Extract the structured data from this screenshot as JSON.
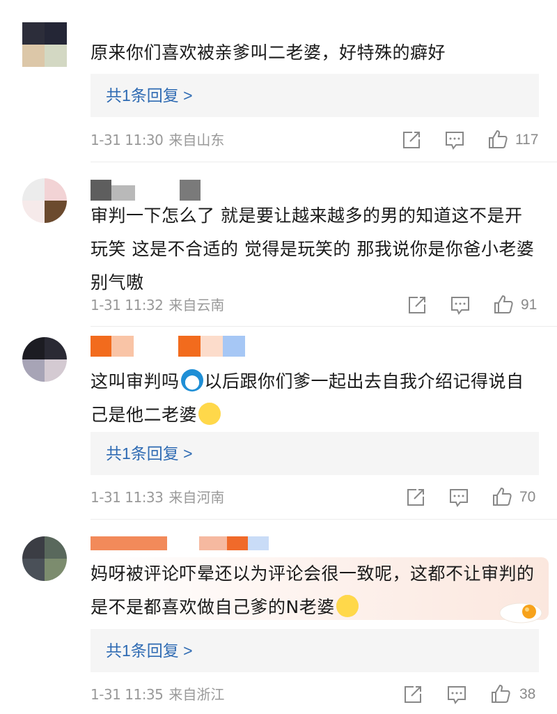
{
  "colors": {
    "link": "#2f6bb3",
    "meta": "#999999",
    "reply_bg": "#f5f5f5",
    "divider": "#ececec"
  },
  "comments": [
    {
      "text": "原来你们喜欢被亲爹叫二老婆，好特殊的癖好",
      "reply_label": "共1条回复 >",
      "time": "1-31 11:30",
      "location": "来自山东",
      "likes": "117"
    },
    {
      "text": "审判一下怎么了 就是要让越来越多的男的知道这不是开玩笑 这是不合适的 觉得是玩笑的 那我说你是你爸小老婆 别气嗷",
      "time": "1-31 11:32",
      "location": "来自云南",
      "likes": "91"
    },
    {
      "text_a": "这叫审判吗",
      "text_b": "以后跟你们爹一起出去自我介绍记得说自己是他二老婆",
      "emoji_1": "doraemon",
      "emoji_2": "sweat",
      "reply_label": "共1条回复 >",
      "time": "1-31 11:33",
      "location": "来自河南",
      "likes": "70"
    },
    {
      "text_a": "妈呀被评论吓晕还以为评论会很一致呢，这都不让审判的是不是都喜欢做自己爹的N老婆",
      "emoji_1": "shock",
      "reply_label": "共1条回复 >",
      "time": "1-31 11:35",
      "location": "来自浙江",
      "likes": "38"
    }
  ],
  "icons": {
    "share": "share-icon",
    "comment": "comment-icon",
    "like": "thumbs-up-icon"
  }
}
